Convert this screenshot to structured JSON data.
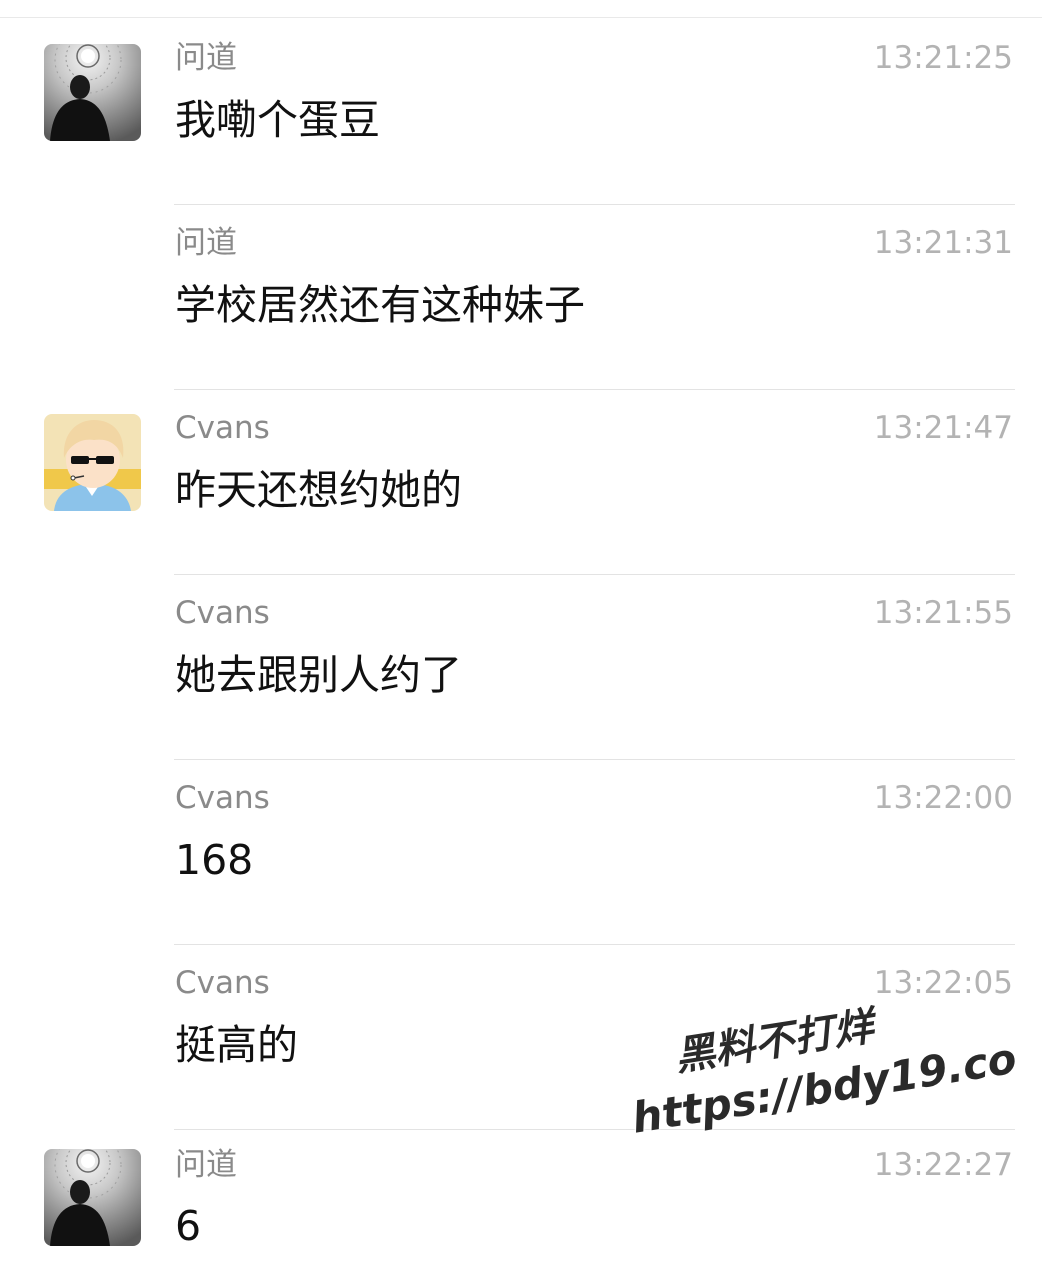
{
  "messages": [
    {
      "sender": "问道",
      "time": "13:21:25",
      "text": "我嘞个蛋豆",
      "avatar": "dark-figure-avatar-icon"
    },
    {
      "sender": "问道",
      "time": "13:21:31",
      "text": "学校居然还有这种妹子",
      "avatar": null
    },
    {
      "sender": "Cvans",
      "time": "13:21:47",
      "text": "昨天还想约她的",
      "avatar": "cartoon-boy-sunglasses-avatar-icon"
    },
    {
      "sender": "Cvans",
      "time": "13:21:55",
      "text": "她去跟别人约了",
      "avatar": null
    },
    {
      "sender": "Cvans",
      "time": "13:22:00",
      "text": "168",
      "avatar": null
    },
    {
      "sender": "Cvans",
      "time": "13:22:05",
      "text": "挺高的",
      "avatar": null
    },
    {
      "sender": "问道",
      "time": "13:22:27",
      "text": "6",
      "avatar": "dark-figure-avatar-icon"
    }
  ],
  "watermark": {
    "title": "黑料不打烊",
    "url": "https://bdy19.co"
  }
}
